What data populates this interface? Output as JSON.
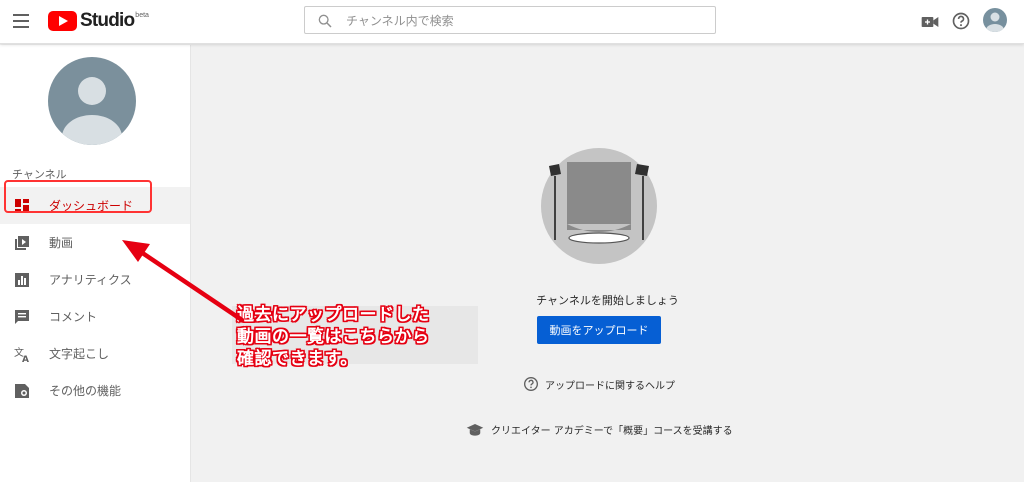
{
  "header": {
    "logo_text": "Studio",
    "logo_badge": "beta",
    "search_placeholder": "チャンネル内で検索",
    "icons": [
      "menu-icon",
      "video-camera-icon",
      "help-icon",
      "avatar"
    ]
  },
  "sidebar": {
    "section_label": "チャンネル",
    "items": [
      {
        "label": "ダッシュボード",
        "icon": "dashboard-icon",
        "active": true
      },
      {
        "label": "動画",
        "icon": "video-library-icon",
        "active": false
      },
      {
        "label": "アナリティクス",
        "icon": "analytics-icon",
        "active": false
      },
      {
        "label": "コメント",
        "icon": "comment-icon",
        "active": false
      },
      {
        "label": "文字起こし",
        "icon": "translate-icon",
        "active": false
      },
      {
        "label": "その他の機能",
        "icon": "more-features-icon",
        "active": false
      }
    ]
  },
  "main": {
    "start_text": "チャンネルを開始しましょう",
    "upload_button": "動画をアップロード",
    "help_link": "アップロードに関するヘルプ",
    "academy_link": "クリエイター アカデミーで「概要」コースを受講する"
  },
  "annotation": {
    "lines": [
      "過去にアップロードした",
      "動画の一覧はこちらから",
      "確認できます。"
    ]
  },
  "colors": {
    "accent_red": "#cc0000",
    "annotation_red": "#e60012",
    "button_blue": "#065fd4"
  }
}
